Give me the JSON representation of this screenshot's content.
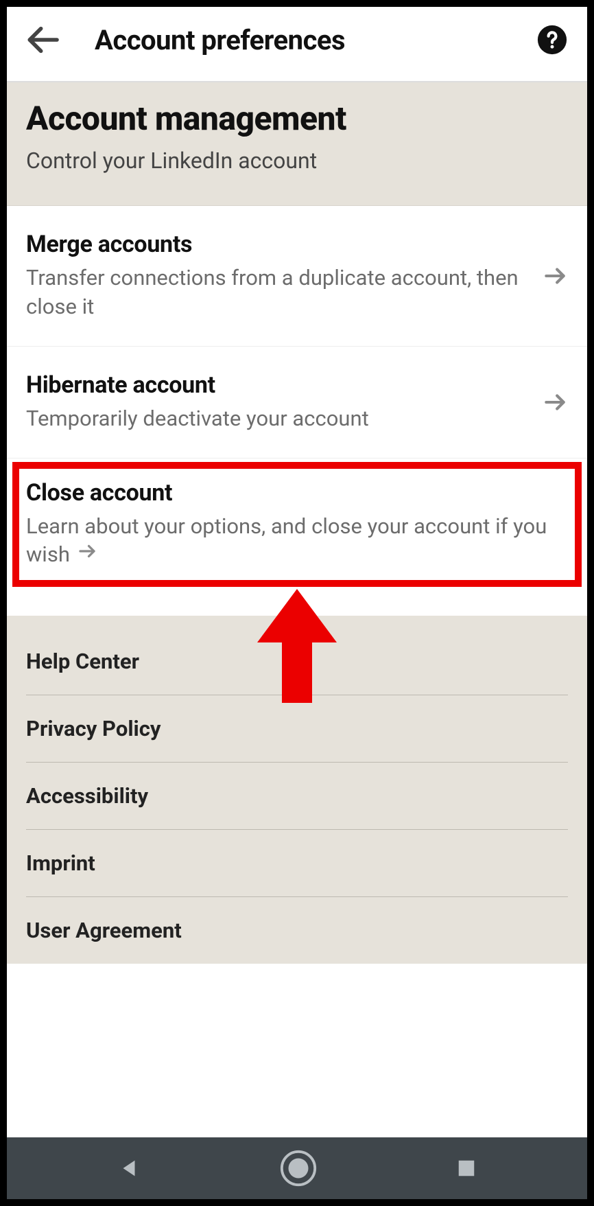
{
  "appbar": {
    "title": "Account preferences"
  },
  "section": {
    "title": "Account management",
    "subtitle": "Control your LinkedIn account"
  },
  "items": [
    {
      "title": "Merge accounts",
      "desc": "Transfer connections from a duplicate account, then close it"
    },
    {
      "title": "Hibernate account",
      "desc": "Temporarily deactivate your account"
    },
    {
      "title": "Close account",
      "desc": "Learn about your options, and close your account if you wish"
    }
  ],
  "footer_links": [
    "Help Center",
    "Privacy Policy",
    "Accessibility",
    "Imprint",
    "User Agreement"
  ],
  "annotation": {
    "highlight_color": "#eb0000"
  }
}
